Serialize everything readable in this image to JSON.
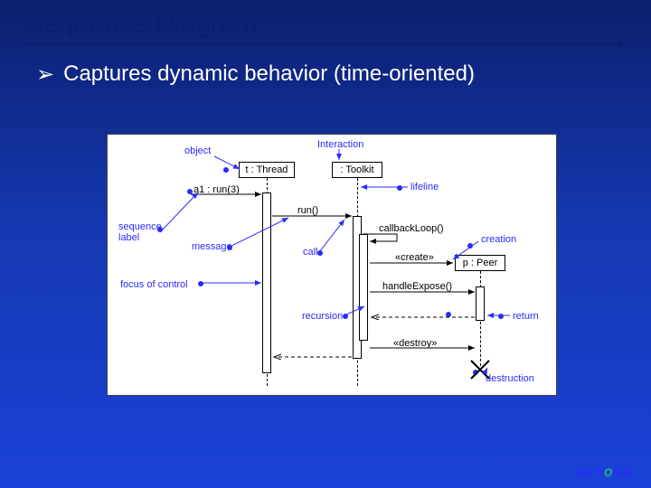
{
  "title": "Sequence Diagram",
  "bullet": "Captures dynamic behavior (time-oriented)",
  "labels": {
    "object": "object",
    "interaction": "Interaction",
    "lifeline": "lifeline",
    "sequence_label": "sequence\nlabel",
    "message": "message",
    "focus": "focus of control",
    "recursion": "recursion",
    "call": "call",
    "creation": "creation",
    "return": "return",
    "destruction": "destruction"
  },
  "objects": {
    "t_thread": "t : Thread",
    "toolkit": ": Toolkit",
    "p_peer": "p : Peer"
  },
  "messages": {
    "a1": "a1 : run(3)",
    "run": "run()",
    "callback": "callbackLoop()",
    "create": "«create»",
    "handle": "handleExpose()",
    "destroy": "«destroy»"
  },
  "logo": {
    "brand": "RATIONAL"
  }
}
